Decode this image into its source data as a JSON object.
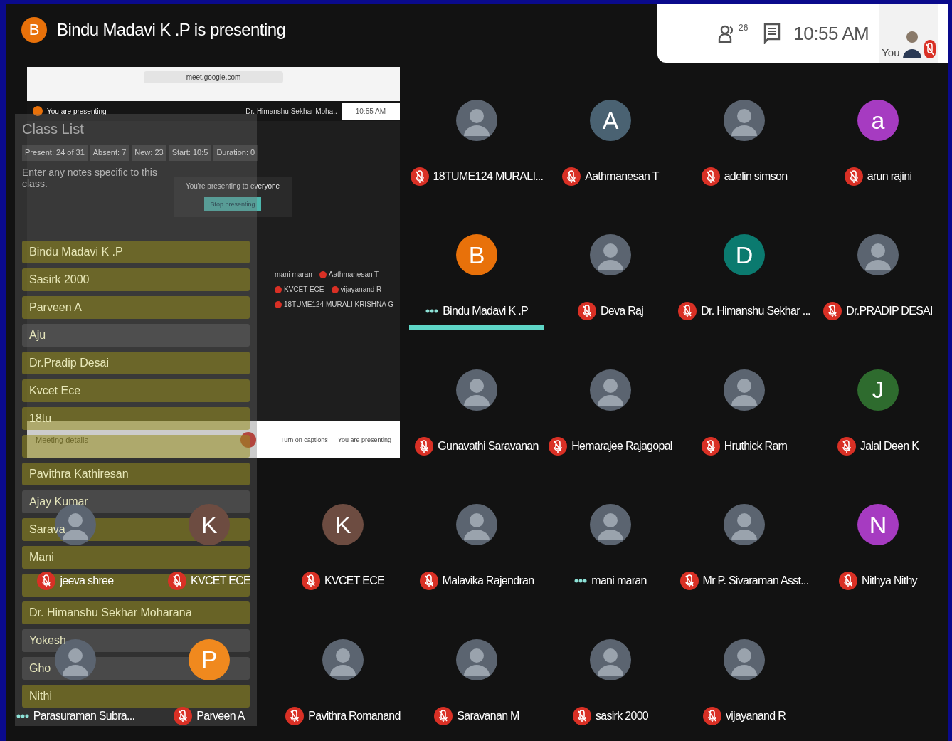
{
  "header": {
    "avatar_letter": "B",
    "title": "Bindu Madavi K .P is presenting"
  },
  "top_bar": {
    "participants_count": "26",
    "time": "10:55 AM",
    "self_label": "You",
    "self_muted": true
  },
  "presentation": {
    "url": "meet.google.com",
    "presenting_label": "You are presenting",
    "mini_presenter": "Dr. Himanshu Sekhar Moha..",
    "mini_time": "10:55 AM",
    "mini_tiles": [
      {
        "name": "mani maran",
        "muted": false
      },
      {
        "name": "Aathmanesan T",
        "muted": true
      },
      {
        "name": "KVCET ECE",
        "muted": true
      },
      {
        "name": "vijayanand R",
        "muted": true
      },
      {
        "name": "18TUME124 MURALI KRISHNA G",
        "muted": true
      }
    ],
    "notice": "You're presenting to everyone",
    "stop_button": "Stop presenting",
    "meeting_details": "Meeting details",
    "captions": "Turn on captions",
    "you_presenting": "You are presenting"
  },
  "class_list": {
    "title": "Class List",
    "stats": [
      "Present: 24 of 31",
      "Absent: 7",
      "New: 23",
      "Start: 10:5",
      "Duration: 0"
    ],
    "notes_placeholder": "Enter any notes specific to this class.",
    "rows": [
      {
        "name": "Bindu Madavi K .P",
        "present": true
      },
      {
        "name": "Sasirk 2000",
        "present": true
      },
      {
        "name": "Parveen A",
        "present": true
      },
      {
        "name": "Aju",
        "present": false
      },
      {
        "name": "Dr.Pradip Desai",
        "present": true
      },
      {
        "name": "Kvcet Ece",
        "present": true
      },
      {
        "name": "18tu",
        "present": true
      },
      {
        "present": true
      },
      {
        "name": "Pavithra Kathiresan",
        "present": true
      },
      {
        "name": "Ajay Kumar",
        "present": false
      },
      {
        "name": "Sarava",
        "present": true
      },
      {
        "name": "Mani",
        "present": true
      },
      {
        "present": true
      },
      {
        "name": "Dr. Himanshu Sekhar Moharana",
        "present": true
      },
      {
        "name": "Yokesh",
        "present": false
      },
      {
        "name": "Gho",
        "present": false
      },
      {
        "name": "Nithi",
        "present": true
      }
    ]
  },
  "tiles": [
    {
      "name": "18TUME124 MURALI...",
      "muted": true,
      "speaking": false,
      "active": false
    },
    {
      "name": "Aathmanesan T",
      "letter": "A",
      "color": "#4a6272",
      "muted": true,
      "speaking": false,
      "active": false
    },
    {
      "name": "adelin simson",
      "muted": true,
      "speaking": false,
      "active": false
    },
    {
      "name": "arun rajini",
      "letter": "a",
      "color": "#a63bc1",
      "muted": true,
      "speaking": false,
      "active": false
    },
    {
      "name": "Bindu Madavi K .P",
      "letter": "B",
      "color": "#e8710a",
      "muted": false,
      "speaking": true,
      "active": true
    },
    {
      "name": "Deva Raj",
      "muted": true,
      "speaking": false,
      "active": false
    },
    {
      "name": "Dr. Himanshu Sekhar ...",
      "letter": "D",
      "color": "#0b7a6f",
      "muted": true,
      "speaking": false,
      "active": false
    },
    {
      "name": "Dr.PRADIP DESAI",
      "muted": true,
      "speaking": false,
      "active": false
    },
    {
      "name": "Gunavathi Saravanan",
      "muted": true,
      "speaking": false,
      "active": false
    },
    {
      "name": "Hemarajee Rajagopal",
      "muted": true,
      "speaking": false,
      "active": false
    },
    {
      "name": "Hruthick Ram",
      "muted": true,
      "speaking": false,
      "active": false
    },
    {
      "name": "Jalal Deen K",
      "letter": "J",
      "color": "#2e6b2e",
      "muted": true,
      "speaking": false,
      "active": false
    },
    {
      "name": "jeeva shree",
      "muted": true,
      "speaking": false,
      "active": false
    },
    {
      "name": "KVCET ECE",
      "letter": "K",
      "color": "#6d4c41",
      "muted": true,
      "speaking": false,
      "active": false
    },
    {
      "name": "KVCET ECE",
      "letter": "K",
      "color": "#6d4c41",
      "muted": true,
      "speaking": false,
      "active": false
    },
    {
      "name": "Malavika Rajendran",
      "muted": true,
      "speaking": false,
      "active": false
    },
    {
      "name": "mani maran",
      "muted": false,
      "speaking": true,
      "active": false
    },
    {
      "name": "Mr P. Sivaraman Asst...",
      "muted": true,
      "speaking": false,
      "active": false
    },
    {
      "name": "Nithya Nithy",
      "letter": "N",
      "color": "#a63bc1",
      "muted": true,
      "speaking": false,
      "active": false
    },
    {
      "name": "Parasuraman Subra...",
      "muted": false,
      "speaking": true,
      "active": false
    },
    {
      "name": "Parveen A",
      "letter": "P",
      "color": "#f0891e",
      "muted": true,
      "speaking": false,
      "active": false
    },
    {
      "name": "Pavithra Romanand",
      "muted": true,
      "speaking": false,
      "active": false
    },
    {
      "name": "Saravanan M",
      "muted": true,
      "speaking": false,
      "active": false
    },
    {
      "name": "sasirk 2000",
      "muted": true,
      "speaking": false,
      "active": false
    },
    {
      "name": "vijayanand R",
      "muted": true,
      "speaking": false,
      "active": false
    }
  ]
}
